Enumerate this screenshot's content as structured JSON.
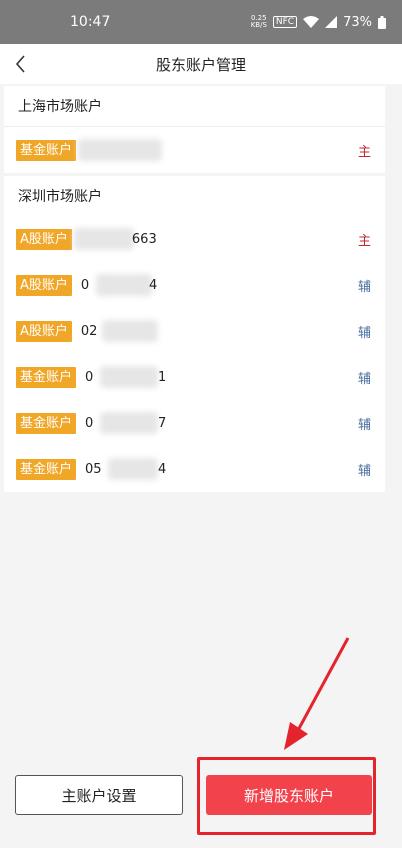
{
  "status_bar": {
    "time": "10:47",
    "speed_value": "0.25",
    "speed_unit": "KB/S",
    "nfc": "NFC",
    "battery": "73%"
  },
  "nav": {
    "title": "股东账户管理"
  },
  "shanghai": {
    "title": "上海市场账户",
    "accounts": [
      {
        "type": "基金账户",
        "number": "",
        "role": "主"
      }
    ]
  },
  "shenzhen": {
    "title": "深圳市场账户",
    "accounts": [
      {
        "type": "A股账户",
        "number": "663",
        "role": "主"
      },
      {
        "type": "A股账户",
        "number": "0",
        "suffix": "4",
        "role": "辅"
      },
      {
        "type": "A股账户",
        "number": "02",
        "suffix": "",
        "role": "辅"
      },
      {
        "type": "基金账户",
        "number": "0",
        "suffix": "1",
        "role": "辅"
      },
      {
        "type": "基金账户",
        "number": "0",
        "suffix": "7",
        "role": "辅"
      },
      {
        "type": "基金账户",
        "number": "05",
        "suffix": "4",
        "role": "辅"
      }
    ]
  },
  "buttons": {
    "primary_account_settings": "主账户设置",
    "add_shareholder_account": "新增股东账户"
  },
  "colors": {
    "badge": "#f0a627",
    "main_role": "#c12830",
    "aux_role": "#4b6fa0",
    "primary_button": "#f2434d",
    "annotation": "#e5232c"
  }
}
